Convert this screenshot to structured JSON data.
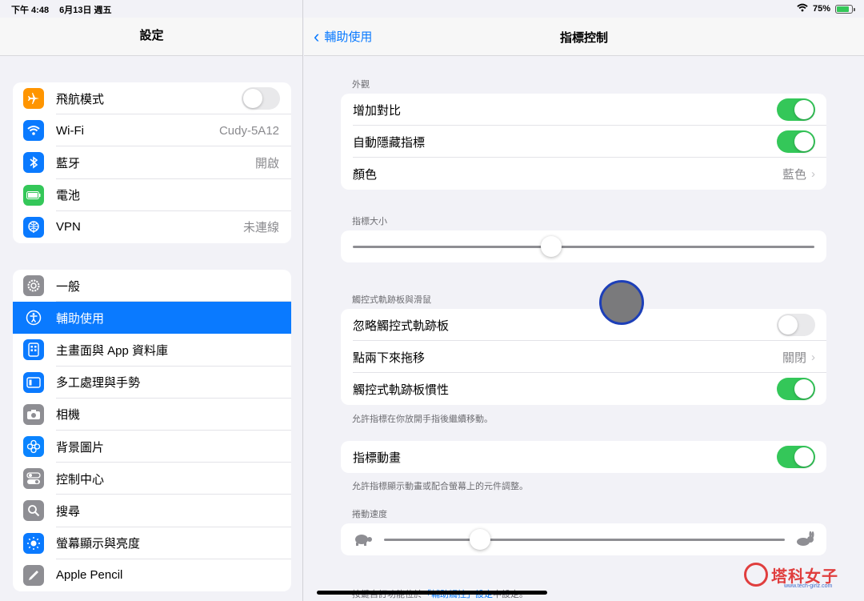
{
  "status": {
    "time": "下午 4:48",
    "date": "6月13日 週五",
    "battery": "75%"
  },
  "sidebar": {
    "title": "設定",
    "group1": [
      {
        "label": "飛航模式",
        "icon": "airplane-icon",
        "color": "#ff9500",
        "toggle": "off"
      },
      {
        "label": "Wi-Fi",
        "icon": "wifi-icon",
        "color": "#0a7aff",
        "value": "Cudy-5A12"
      },
      {
        "label": "藍牙",
        "icon": "bluetooth-icon",
        "color": "#0a7aff",
        "value": "開啟"
      },
      {
        "label": "電池",
        "icon": "battery-icon",
        "color": "#34c759"
      },
      {
        "label": "VPN",
        "icon": "vpn-icon",
        "color": "#0a7aff",
        "value": "未連線"
      }
    ],
    "group2": [
      {
        "label": "一般",
        "icon": "gear-icon",
        "color": "#8e8e93"
      },
      {
        "label": "輔助使用",
        "icon": "accessibility-icon",
        "color": "#0a7aff",
        "selected": true
      },
      {
        "label": "主畫面與 App 資料庫",
        "icon": "home-screen-icon",
        "color": "#0a7aff"
      },
      {
        "label": "多工處理與手勢",
        "icon": "multitasking-icon",
        "color": "#0a7aff"
      },
      {
        "label": "相機",
        "icon": "camera-icon",
        "color": "#8e8e93"
      },
      {
        "label": "背景圖片",
        "icon": "wallpaper-icon",
        "color": "#0a84ff"
      },
      {
        "label": "控制中心",
        "icon": "control-center-icon",
        "color": "#8e8e93"
      },
      {
        "label": "搜尋",
        "icon": "search-icon",
        "color": "#8e8e93"
      },
      {
        "label": "螢幕顯示與亮度",
        "icon": "brightness-icon",
        "color": "#0a7aff"
      },
      {
        "label": "Apple Pencil",
        "icon": "pencil-icon",
        "color": "#8e8e93"
      }
    ]
  },
  "nav": {
    "back": "輔助使用",
    "title": "指標控制"
  },
  "appearance": {
    "label": "外觀",
    "rows": [
      {
        "label": "增加對比",
        "toggle": "on"
      },
      {
        "label": "自動隱藏指標",
        "toggle": "on"
      },
      {
        "label": "顏色",
        "value": "藍色"
      }
    ]
  },
  "pointer_size": {
    "label": "指標大小",
    "value": 0.43
  },
  "trackpad": {
    "label": "觸控式軌跡板與滑鼠",
    "rows": [
      {
        "label": "忽略觸控式軌跡板",
        "toggle": "off"
      },
      {
        "label": "點兩下來拖移",
        "value": "關閉"
      },
      {
        "label": "觸控式軌跡板慣性",
        "toggle": "on"
      }
    ],
    "footnote": "允許指標在你放開手指後繼續移動。"
  },
  "animation": {
    "label": "指標動畫",
    "toggle": "on",
    "footnote": "允許指標顯示動畫或配合螢幕上的元件調整。"
  },
  "scroll_speed": {
    "label": "捲動速度",
    "value": 0.24
  },
  "bottom_note": {
    "prefix": "按鍵自訂功能位於",
    "link": "「輔助觸控」設定",
    "suffix": "中設定。"
  },
  "watermark": {
    "text": "塔科女子",
    "sub": "www.tech-girlz.com"
  }
}
